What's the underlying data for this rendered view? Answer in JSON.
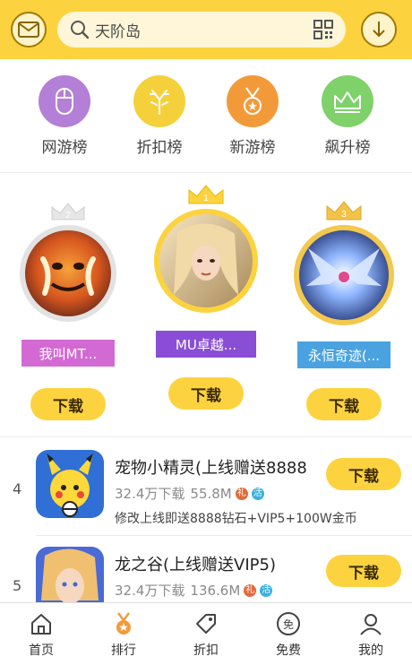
{
  "header": {
    "search_placeholder": "天阶岛",
    "mail_icon": "mail-icon",
    "qr_icon": "qr-scan-icon",
    "download_icon": "download-icon",
    "accent_color": "#fcd33f"
  },
  "categories": [
    {
      "label": "网游榜",
      "icon": "mouse-icon",
      "color": "#b47fd6"
    },
    {
      "label": "折扣榜",
      "icon": "antlers-icon",
      "color": "#f4d13a"
    },
    {
      "label": "新游榜",
      "icon": "medal-icon",
      "color": "#f29a3a"
    },
    {
      "label": "飙升榜",
      "icon": "crown-icon",
      "color": "#7fd16a"
    }
  ],
  "podium": [
    {
      "rank": "2",
      "name": "我叫MT...",
      "download_label": "下载",
      "ribbon_color": "#d36ad3"
    },
    {
      "rank": "1",
      "name": "MU卓越...",
      "download_label": "下载",
      "ribbon_color": "#8a4ed6"
    },
    {
      "rank": "3",
      "name": "永恒奇迹(...",
      "download_label": "下载",
      "ribbon_color": "#4aa3e0"
    }
  ],
  "list": [
    {
      "rank": "4",
      "name": "宠物小精灵(上线赠送8888",
      "downloads": "32.4万下载",
      "size": "55.8M",
      "tags": [
        "礼",
        "活"
      ],
      "desc": "修改上线即送8888钻石+VIP5+100W金币",
      "download_label": "下载"
    },
    {
      "rank": "5",
      "name": "龙之谷(上线赠送VIP5)",
      "downloads": "32.4万下载",
      "size": "136.6M",
      "tags": [
        "礼",
        "活"
      ],
      "desc": "",
      "download_label": "下载"
    }
  ],
  "tabs": [
    {
      "label": "首页",
      "icon": "home-icon",
      "active": false
    },
    {
      "label": "排行",
      "icon": "rank-medal-icon",
      "active": true
    },
    {
      "label": "折扣",
      "icon": "tag-icon",
      "active": false
    },
    {
      "label": "免费",
      "icon": "free-icon",
      "active": false
    },
    {
      "label": "我的",
      "icon": "user-icon",
      "active": false
    }
  ]
}
